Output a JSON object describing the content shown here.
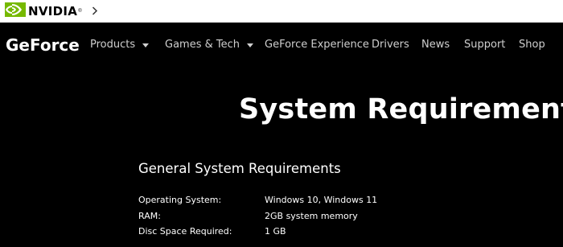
{
  "topbar": {
    "logo_text": "NVIDIA",
    "logo_mark": "®",
    "logo_icon": "nvidia-eye-icon",
    "crumb_icon": "chevron-right-icon"
  },
  "navbar": {
    "brand": "GeForce",
    "items": [
      {
        "label": "Products",
        "has_dropdown": true
      },
      {
        "label": "Games & Tech",
        "has_dropdown": true
      },
      {
        "label": "GeForce Experience",
        "has_dropdown": false
      },
      {
        "label": "Drivers",
        "has_dropdown": false
      },
      {
        "label": "News",
        "has_dropdown": false
      },
      {
        "label": "Support",
        "has_dropdown": false
      },
      {
        "label": "Shop",
        "has_dropdown": false
      }
    ]
  },
  "page": {
    "title": "System Requirements",
    "section_title": "General System Requirements",
    "requirements": [
      {
        "label": "Operating System:",
        "value": "Windows 10, Windows 11"
      },
      {
        "label": "RAM:",
        "value": "2GB system memory"
      },
      {
        "label": "Disc Space Required:",
        "value": "1 GB"
      }
    ]
  },
  "colors": {
    "nvidia_green": "#76b900",
    "background": "#000000",
    "nav_text": "#cfcfcf"
  }
}
